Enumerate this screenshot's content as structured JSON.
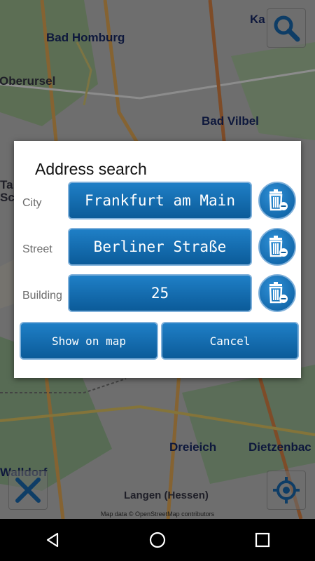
{
  "map": {
    "towns": [
      {
        "label": "Bad Homburg"
      },
      {
        "label": "Oberursel"
      },
      {
        "label": "Bad Vilbel"
      },
      {
        "label": "Ka"
      },
      {
        "label": "Ta"
      },
      {
        "label": "Sch"
      },
      {
        "label": "Dreieich"
      },
      {
        "label": "Dietzenbac"
      },
      {
        "label": "Walldorf"
      },
      {
        "label": "Langen (Hessen)"
      }
    ],
    "attribution": "Map data © OpenStreetMap contributors"
  },
  "dialog": {
    "title": "Address search",
    "fields": [
      {
        "label": "City",
        "value": "Frankfurt am Main"
      },
      {
        "label": "Street",
        "value": "Berliner Straße"
      },
      {
        "label": "Building",
        "value": "25"
      }
    ],
    "show_on_map_label": "Show on map",
    "cancel_label": "Cancel"
  },
  "colors": {
    "accent": "#0b5b99",
    "accent_light": "#1f7fc6",
    "button_border": "#7fb0da"
  },
  "icons": {
    "search": "search-icon",
    "clear": "trash-icon",
    "crosshair": "crosshair-icon",
    "gps": "location-target-icon",
    "nav_back": "back-triangle-icon",
    "nav_home": "home-circle-icon",
    "nav_recent": "recent-square-icon"
  }
}
